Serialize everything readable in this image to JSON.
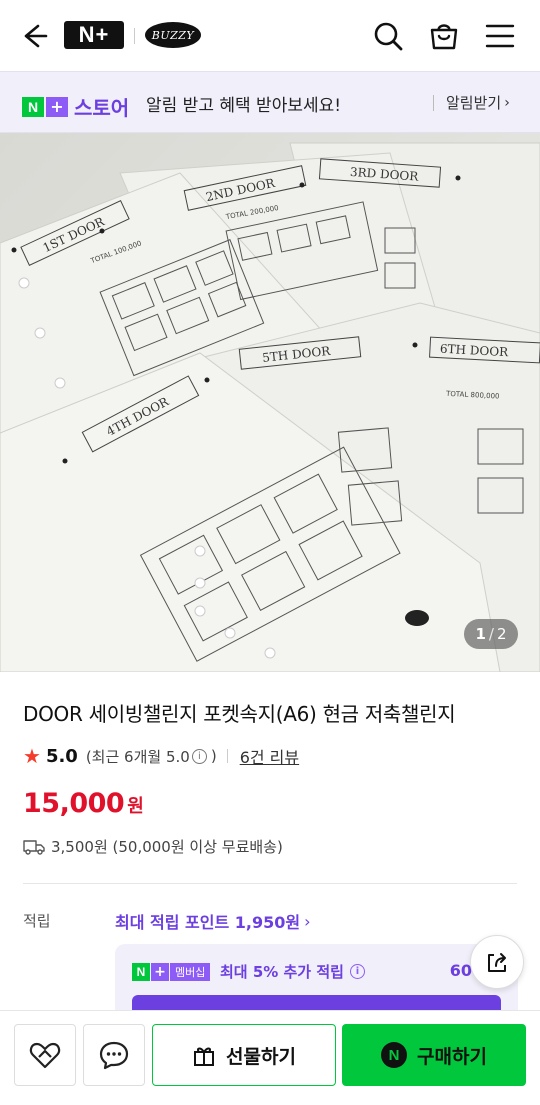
{
  "header": {
    "logo_text": "N+",
    "brand_text": "BUZZY",
    "icons": [
      "back-arrow-icon",
      "search-icon",
      "shopping-bag-icon",
      "menu-icon"
    ]
  },
  "store_banner": {
    "store_label": "스토어",
    "message": "알림 받고 혜택 받아보세요!",
    "alarm_link": "알림받기"
  },
  "gallery": {
    "current": "1",
    "separator": "/",
    "total": "2",
    "photo_texts": [
      "1ST DOOR",
      "2ND DOOR",
      "3RD DOOR",
      "4TH DOOR",
      "5TH DOOR",
      "6TH DOOR",
      "TOTAL 100,000",
      "TOTAL 200,000",
      "TOTAL 800,000"
    ]
  },
  "product": {
    "title": "DOOR 세이빙챌린지 포켓속지(A6) 현금 저축챌린지",
    "rating": "5.0",
    "rating_recent": "(최근 6개월 5.0",
    "rating_recent_close": ")",
    "review_link": "6건 리뷰",
    "price": "15,000",
    "price_unit": "원",
    "shipping": "3,500원 (50,000원 이상 무료배송)"
  },
  "points": {
    "label": "적립",
    "max_link": "최대 적립 포인트 1,950원",
    "membership_badge": "멤버십",
    "membership_text": "최대 5% 추가 적립",
    "membership_amount": "60"
  },
  "bottom_bar": {
    "gift_label": "선물하기",
    "buy_label": "구매하기",
    "buy_badge": "N"
  },
  "colors": {
    "naver_green": "#00c73c",
    "plus_purple": "#8d5cf6",
    "store_purple": "#6c3fe0",
    "price_red": "#e0112b",
    "star_red": "#f53b2c"
  }
}
